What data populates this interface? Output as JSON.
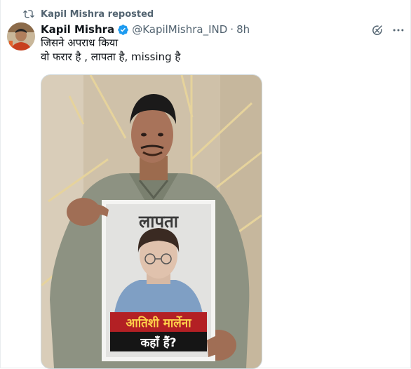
{
  "repost": {
    "label": "Kapil Mishra reposted"
  },
  "author": {
    "name": "Kapil Mishra",
    "handle": "@KapilMishra_IND",
    "separator": "·",
    "time": "8h",
    "verified": true,
    "verified_color": "#1d9bf0"
  },
  "tweet": {
    "lines": [
      "जिसने अपराध किया",
      "वो फरार है , लापता है, missing है"
    ]
  },
  "media": {
    "poster_top": "लापता",
    "poster_name": "आतिशी मार्लेना",
    "poster_question": "कहाँ हैं?"
  },
  "icons": {
    "repost": "repost-icon",
    "verified": "verified-badge-icon",
    "grok": "grok-icon",
    "more": "more-options-icon"
  }
}
